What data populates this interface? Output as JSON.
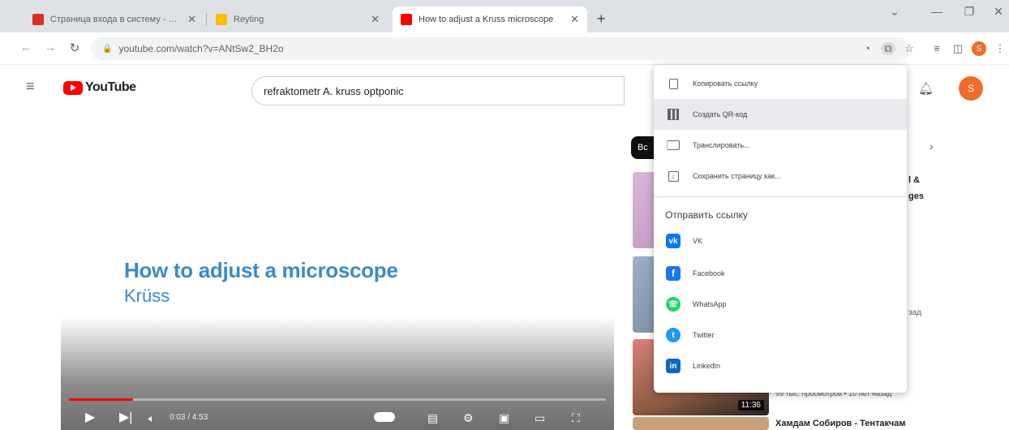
{
  "tabs": [
    {
      "title": "Страница входа в систему - Ko...",
      "favicon_color": "#d93025"
    },
    {
      "title": "Reyting",
      "favicon_color": "#fbbc04"
    },
    {
      "title": "How to adjust a Kruss microscope",
      "favicon_color": "#ff0000"
    }
  ],
  "new_tab": "+",
  "address": "youtube.com/watch?v=ANtSw2_BH2o",
  "profile_initial": "S",
  "youtube": {
    "logo_text": "YouTube",
    "search_value": "refraktometr A. kruss optponic",
    "avatar_initial": "S"
  },
  "video": {
    "title": "How to adjust a microscope",
    "subtitle": "Krüss",
    "time": "0:03 / 4:53",
    "progress": 0.12
  },
  "sidebar": {
    "chip_label": "Вс",
    "frag1": "l &",
    "frag2": "ges",
    "frag3": "зад",
    "duration": "11:36",
    "views": "99 тыс. просмотров • 10 лет назад",
    "next_title": "Хамдам Собиров - Тентакчам"
  },
  "menu": {
    "items": [
      {
        "label": "Копировать ссылку",
        "icon": "copy-icon"
      },
      {
        "label": "Создать QR-код",
        "icon": "qr-code-icon"
      },
      {
        "label": "Транслировать...",
        "icon": "cast-icon"
      },
      {
        "label": "Сохранить страницу как...",
        "icon": "save-page-icon"
      }
    ],
    "share_heading": "Отправить ссылку",
    "share": [
      {
        "label": "VK",
        "color": "#0077ff"
      },
      {
        "label": "Facebook",
        "color": "#1877f2"
      },
      {
        "label": "WhatsApp",
        "color": "#25d366"
      },
      {
        "label": "Twitter",
        "color": "#1d9bf0"
      },
      {
        "label": "LinkedIn",
        "color": "#0a66c2"
      }
    ]
  },
  "colors": {
    "youtube_red": "#ff0000",
    "avatar": "#ef6c2b",
    "title_blue": "#3a8cc6"
  }
}
